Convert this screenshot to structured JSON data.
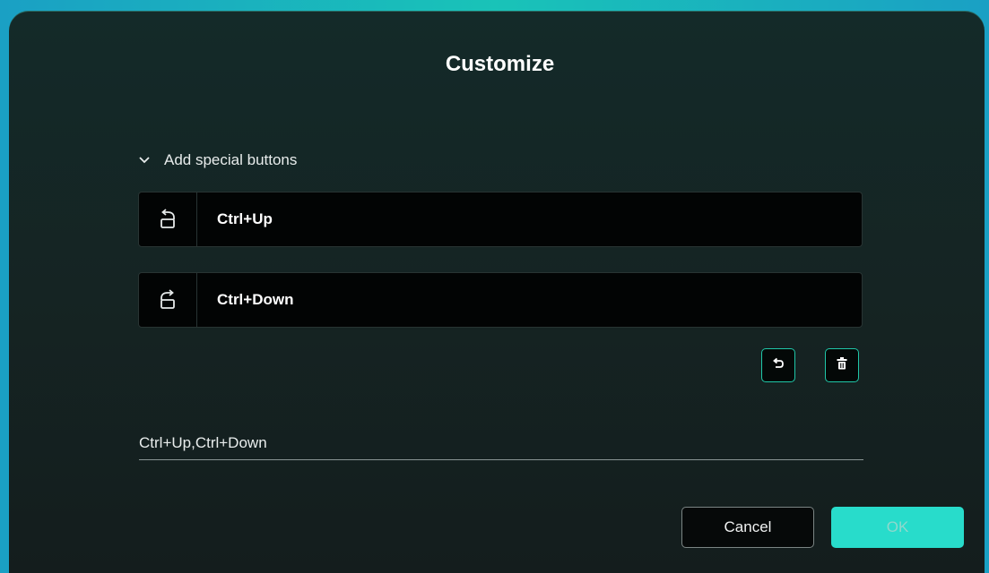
{
  "dialog": {
    "title": "Customize"
  },
  "section": {
    "label": "Add special buttons",
    "icon": "chevron-down-icon"
  },
  "keys": [
    {
      "label": "Ctrl+Up",
      "icon": "rotate-ccw-icon"
    },
    {
      "label": "Ctrl+Down",
      "icon": "rotate-cw-icon"
    }
  ],
  "actions": {
    "undo_icon": "undo-icon",
    "delete_icon": "trash-icon"
  },
  "value": {
    "text": "Ctrl+Up,Ctrl+Down"
  },
  "footer": {
    "cancel_label": "Cancel",
    "ok_label": "OK"
  },
  "colors": {
    "accent": "#28dccb",
    "border_accent": "#1fc7a8",
    "background": "#152423"
  }
}
